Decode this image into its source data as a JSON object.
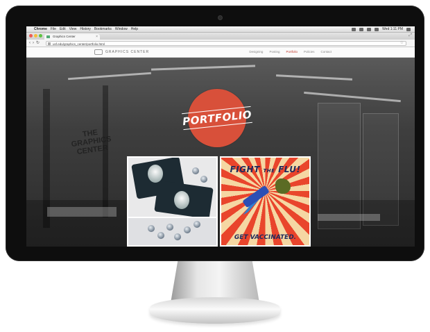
{
  "os_menubar": {
    "apple": "",
    "app_name": "Chrome",
    "items": [
      "File",
      "Edit",
      "View",
      "History",
      "Bookmarks",
      "Window",
      "Help"
    ],
    "clock": "Wed 1:11 PM"
  },
  "browser": {
    "tab_title": "Graphics Center",
    "tab_close": "×",
    "url": "usf.edu/graphics_center/portfolio.html",
    "back": "‹",
    "forward": "›",
    "reload": "↻",
    "star": "☆",
    "fullscreen": "⤢"
  },
  "site": {
    "name": "GRAPHICS CENTER",
    "nav": [
      "Designing",
      "Posting",
      "Portfolio",
      "Policies",
      "Contact"
    ],
    "active_nav": "Portfolio",
    "wall_text": "THE GRAPHICS CENTER",
    "badge_text": "PORTFOLIO",
    "badge_color": "#d8503a",
    "poster": {
      "title_1": "FIGHT",
      "title_2": "THE",
      "title_3": "FLU!",
      "bottom": "GET VACCINATED."
    }
  },
  "icons": {
    "menu_right": [
      "bluetooth-icon",
      "wifi-icon",
      "volume-icon",
      "battery-icon",
      "search-icon"
    ]
  }
}
